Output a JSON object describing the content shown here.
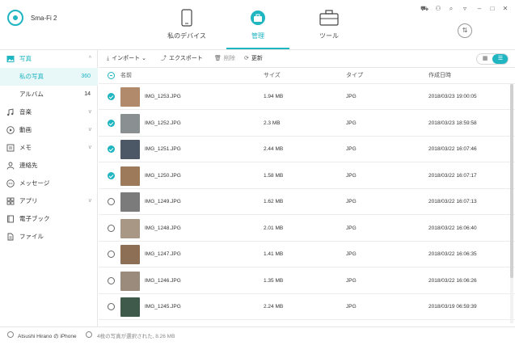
{
  "app": {
    "title": "Sma-Fi 2"
  },
  "nav": [
    {
      "label": "私のデバイス",
      "icon": "phone-icon",
      "active": false
    },
    {
      "label": "管理",
      "icon": "toolbox-icon",
      "active": true
    },
    {
      "label": "ツール",
      "icon": "briefcase-icon",
      "active": false
    }
  ],
  "window_controls": [
    "cart-icon",
    "user-icon",
    "search-icon",
    "shield-icon",
    "minimize-icon",
    "maximize-icon",
    "close-icon"
  ],
  "sidebar": {
    "items": [
      {
        "label": "写真",
        "icon": "photo-icon",
        "chevron": "^",
        "group": true
      },
      {
        "label": "私の写真",
        "count": "360",
        "sub": true,
        "selected": true
      },
      {
        "label": "アルバム",
        "count": "14",
        "sub": true
      },
      {
        "label": "音楽",
        "icon": "music-icon",
        "chevron": "v"
      },
      {
        "label": "動画",
        "icon": "video-icon",
        "chevron": "v"
      },
      {
        "label": "メモ",
        "icon": "memo-icon",
        "chevron": "v"
      },
      {
        "label": "連絡先",
        "icon": "contact-icon"
      },
      {
        "label": "メッセージ",
        "icon": "message-icon"
      },
      {
        "label": "アプリ",
        "icon": "apps-icon",
        "chevron": "v"
      },
      {
        "label": "電子ブック",
        "icon": "book-icon"
      },
      {
        "label": "ファイル",
        "icon": "file-icon"
      }
    ]
  },
  "toolbar": {
    "import_label": "インポート",
    "export_label": "エクスポート",
    "delete_label": "削除",
    "refresh_label": "更新"
  },
  "table": {
    "headers": {
      "name": "名前",
      "size": "サイズ",
      "type": "タイプ",
      "date": "作成日時"
    },
    "rows": [
      {
        "name": "IMG_1253.JPG",
        "size": "1.94 MB",
        "type": "JPG",
        "date": "2018/03/23 19:00:05",
        "checked": true,
        "color": "#b08a6a"
      },
      {
        "name": "IMG_1252.JPG",
        "size": "2.3 MB",
        "type": "JPG",
        "date": "2018/03/23 18:59:58",
        "checked": true,
        "color": "#8a8f92"
      },
      {
        "name": "IMG_1251.JPG",
        "size": "2.44 MB",
        "type": "JPG",
        "date": "2018/03/22 16:07:46",
        "checked": true,
        "color": "#4d5866"
      },
      {
        "name": "IMG_1250.JPG",
        "size": "1.58 MB",
        "type": "JPG",
        "date": "2018/03/22 16:07:17",
        "checked": true,
        "color": "#9c7a5a"
      },
      {
        "name": "IMG_1249.JPG",
        "size": "1.62 MB",
        "type": "JPG",
        "date": "2018/03/22 16:07:13",
        "checked": false,
        "color": "#7b7b7b"
      },
      {
        "name": "IMG_1248.JPG",
        "size": "2.01 MB",
        "type": "JPG",
        "date": "2018/03/22 16:06:40",
        "checked": false,
        "color": "#a79784"
      },
      {
        "name": "IMG_1247.JPG",
        "size": "1.41 MB",
        "type": "JPG",
        "date": "2018/03/22 16:06:35",
        "checked": false,
        "color": "#8c6f55"
      },
      {
        "name": "IMG_1246.JPG",
        "size": "1.35 MB",
        "type": "JPG",
        "date": "2018/03/22 16:06:26",
        "checked": false,
        "color": "#9a8b7d"
      },
      {
        "name": "IMG_1245.JPG",
        "size": "2.24 MB",
        "type": "JPG",
        "date": "2018/03/19 06:59:39",
        "checked": false,
        "color": "#3f5a4a"
      }
    ]
  },
  "status": {
    "device": "Atsushi Hirano の iPhone",
    "selection": "4枚の写真が選択された, 8.26 MB"
  },
  "colors": {
    "accent": "#1fb5c1"
  }
}
